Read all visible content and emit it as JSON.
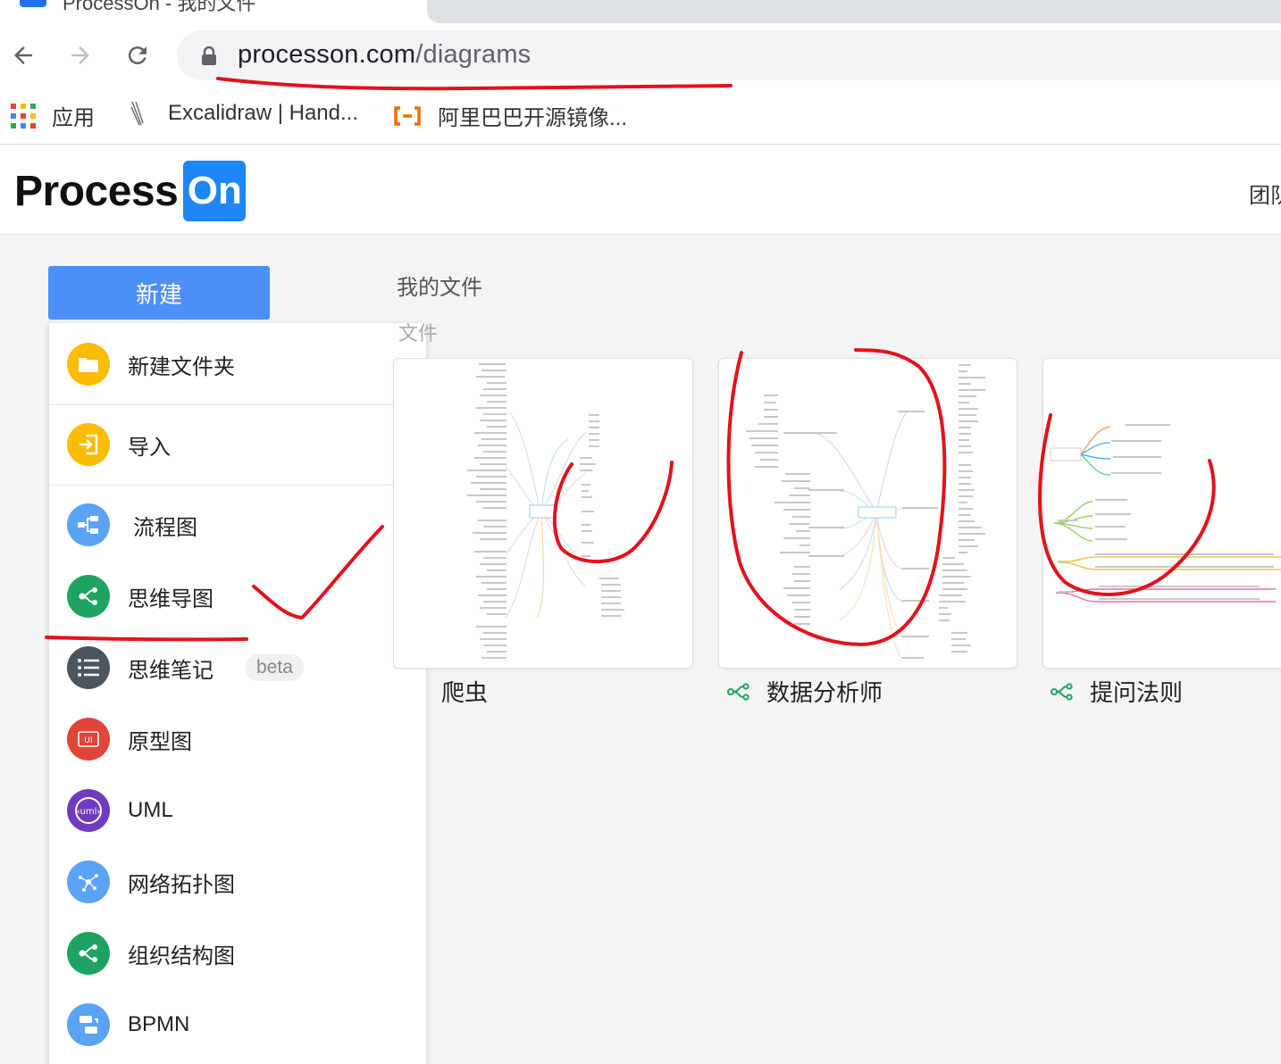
{
  "browser": {
    "tab_title": "ProcessOn - 我的文件",
    "url_host": "processon.com",
    "url_path": "/diagrams",
    "bookmarks": [
      {
        "label": "应用",
        "icon": "apps-grid-icon"
      },
      {
        "label": "Excalidraw | Hand...",
        "icon": "excalidraw-icon"
      },
      {
        "label": "阿里巴巴开源镜像...",
        "icon": "alibaba-icon"
      }
    ]
  },
  "header": {
    "logo_process": "Process",
    "logo_on": "On",
    "team_link": "团队"
  },
  "sidebar": {
    "new_button": "新建",
    "items": [
      {
        "label": "新建文件夹",
        "icon": "folder-icon",
        "color": "#fbbc04"
      },
      {
        "label": "导入",
        "icon": "import-icon",
        "color": "#fbbc04"
      },
      {
        "label": "流程图",
        "icon": "flowchart-icon",
        "color": "#5ba3f5"
      },
      {
        "label": "思维导图",
        "icon": "mindmap-icon",
        "color": "#1ea362"
      },
      {
        "label": "思维笔记",
        "icon": "list-icon",
        "color": "#4a5560",
        "badge": "beta"
      },
      {
        "label": "原型图",
        "icon": "ui-prototype-icon",
        "color": "#e0443a"
      },
      {
        "label": "UML",
        "icon": "uml-icon",
        "color": "#6f3bbf"
      },
      {
        "label": "网络拓扑图",
        "icon": "network-icon",
        "color": "#5ba3f5"
      },
      {
        "label": "组织结构图",
        "icon": "org-chart-icon",
        "color": "#1ea362"
      },
      {
        "label": "BPMN",
        "icon": "bpmn-icon",
        "color": "#5ba3f5"
      }
    ]
  },
  "main": {
    "breadcrumb": "我的文件",
    "section": "文件",
    "files": [
      {
        "title": "爬虫"
      },
      {
        "title": "数据分析师"
      },
      {
        "title": "提问法则"
      }
    ]
  },
  "colors": {
    "brand": "#1f86f5",
    "primary_button": "#4c8ff6",
    "annotation": "#e3121b",
    "mindmap_green": "#1ea362"
  }
}
